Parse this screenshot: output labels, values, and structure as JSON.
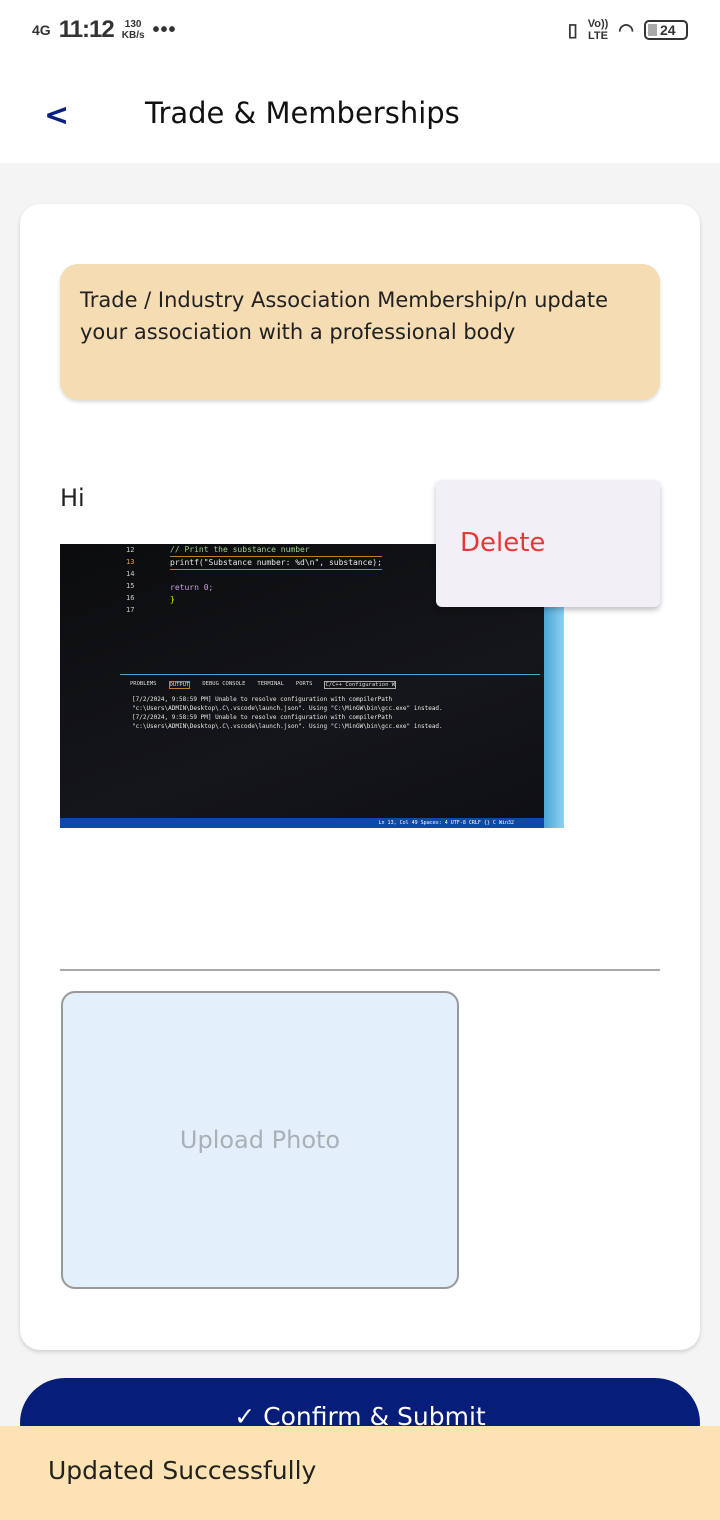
{
  "status_bar": {
    "network": "4G",
    "time": "11:12",
    "speed_value": "130",
    "speed_unit": "KB/s",
    "more": "•••",
    "volte": "Vo))",
    "lte": "LTE",
    "battery": "24"
  },
  "header": {
    "back_icon": "chevron-left",
    "title": "Trade & Memberships"
  },
  "banner": {
    "text": "Trade / Industry Association Membership/n update your association with a professional body"
  },
  "entry": {
    "caption": "Hi",
    "photo": {
      "line_numbers": [
        "12",
        "13",
        "14",
        "15",
        "16",
        "17"
      ],
      "code": [
        "// Print the substance number",
        "printf(\"Substance number: %d\\n\", substance);",
        "",
        "return 0;",
        "}",
        ""
      ],
      "tabs": [
        "PROBLEMS",
        "OUTPUT",
        "DEBUG CONSOLE",
        "TERMINAL",
        "PORTS",
        "C/C++ Configuration W"
      ],
      "output": [
        "[7/2/2024, 9:58:59 PM] Unable to resolve configuration with compilerPath",
        "\"c:\\Users\\ADMIN\\Desktop\\.C\\.vscode\\launch.json\".  Using \"C:\\MinGW\\bin\\gcc.exe\" instead.",
        "[7/2/2024, 9:58:59 PM] Unable to resolve configuration with compilerPath",
        "\"c:\\Users\\ADMIN\\Desktop\\.C\\.vscode\\launch.json\".  Using \"C:\\MinGW\\bin\\gcc.exe\" instead."
      ],
      "statusbar": "Ln 13, Col 49   Spaces: 4   UTF-8   CRLF   {} C   Win32"
    }
  },
  "context_menu": {
    "delete_label": "Delete"
  },
  "upload": {
    "label": "Upload Photo"
  },
  "submit": {
    "label": "✓ Confirm & Submit"
  },
  "snackbar": {
    "message": "Updated Successfully"
  },
  "colors": {
    "primary": "#061d7a",
    "banner": "#f5dcb3",
    "danger": "#e53935",
    "snackbar": "#fde3b3"
  }
}
